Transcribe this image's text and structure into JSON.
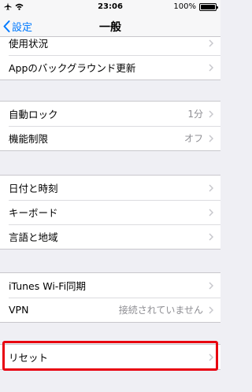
{
  "status_bar": {
    "time": "23:06",
    "battery_percent": "100%",
    "airplane_icon": "airplane-icon",
    "wifi_icon": "wifi-icon"
  },
  "nav": {
    "back_label": "設定",
    "title": "一般"
  },
  "groups": [
    {
      "items": [
        {
          "label": "使用状況"
        },
        {
          "label": "Appのバックグラウンド更新"
        }
      ]
    },
    {
      "items": [
        {
          "label": "自動ロック",
          "value": "1分"
        },
        {
          "label": "機能制限",
          "value": "オフ"
        }
      ]
    },
    {
      "items": [
        {
          "label": "日付と時刻"
        },
        {
          "label": "キーボード"
        },
        {
          "label": "言語と地域"
        }
      ]
    },
    {
      "items": [
        {
          "label": "iTunes Wi-Fi同期"
        },
        {
          "label": "VPN",
          "value": "接続されていません"
        }
      ]
    },
    {
      "items": [
        {
          "label": "リセット"
        }
      ]
    }
  ],
  "highlight_color": "#e8000f",
  "accent_color": "#007aff"
}
